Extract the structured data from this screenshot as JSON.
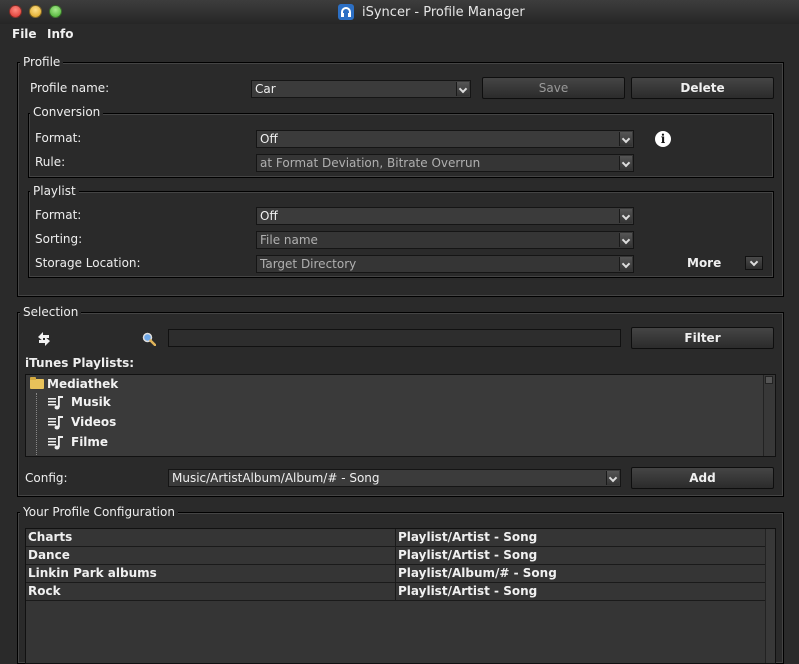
{
  "window": {
    "title": "iSyncer - Profile Manager",
    "accent": "#2c6fc4"
  },
  "menu": {
    "items": [
      "File",
      "Info"
    ]
  },
  "profile": {
    "group_title": "Profile",
    "name_label": "Profile name:",
    "name_value": "Car",
    "save_label": "Save",
    "delete_label": "Delete",
    "conversion": {
      "title": "Conversion",
      "format_label": "Format:",
      "format_value": "Off",
      "rule_label": "Rule:",
      "rule_value": "at Format Deviation, Bitrate Overrun",
      "info_icon": "i"
    },
    "playlist": {
      "title": "Playlist",
      "format_label": "Format:",
      "format_value": "Off",
      "sorting_label": "Sorting:",
      "sorting_value": "File name",
      "storage_label": "Storage Location:",
      "storage_value": "Target Directory",
      "more_label": "More"
    }
  },
  "selection": {
    "group_title": "Selection",
    "search_value": "",
    "filter_label": "Filter",
    "playlists_label": "iTunes Playlists:",
    "tree": [
      {
        "label": "Mediathek",
        "icon": "folder-icon"
      },
      {
        "label": "Musik",
        "icon": "playlist-icon"
      },
      {
        "label": "Videos",
        "icon": "playlist-icon"
      },
      {
        "label": "Filme",
        "icon": "playlist-icon"
      }
    ],
    "config_label": "Config:",
    "config_value": "Music/ArtistAlbum/Album/# - Song",
    "add_label": "Add"
  },
  "configuration": {
    "group_title": "Your Profile Configuration",
    "rows": [
      {
        "playlist": "Charts",
        "pattern": "Playlist/Artist - Song"
      },
      {
        "playlist": "Dance",
        "pattern": "Playlist/Artist - Song"
      },
      {
        "playlist": "Linkin Park albums",
        "pattern": "Playlist/Album/# - Song"
      },
      {
        "playlist": "Rock",
        "pattern": "Playlist/Artist - Song"
      }
    ]
  }
}
